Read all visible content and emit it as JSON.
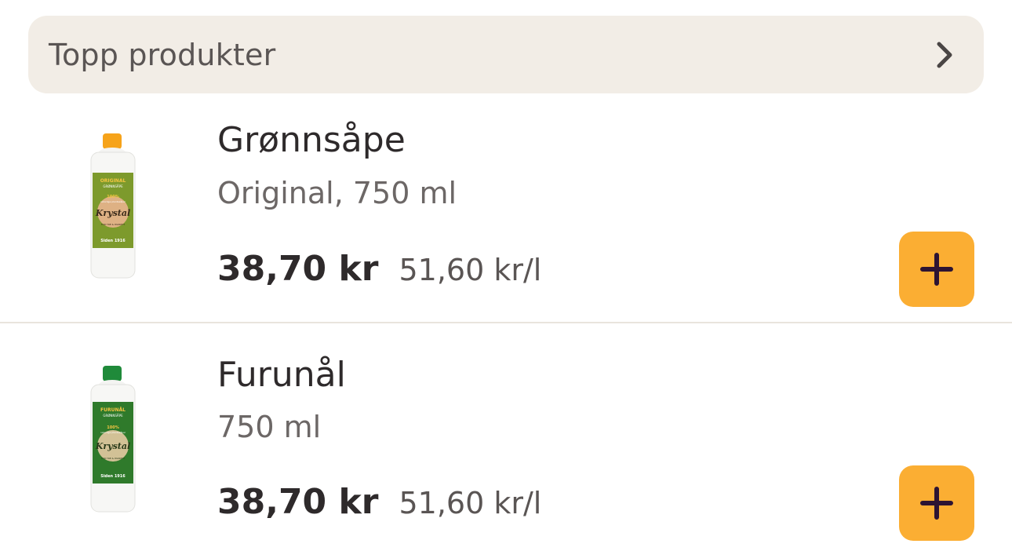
{
  "header": {
    "title": "Topp produkter",
    "icon": "chevron-right-icon"
  },
  "products": [
    {
      "name": "Grønnsåpe",
      "description": "Original, 750 ml",
      "price": "38,70 kr",
      "unit_price": "51,60 kr/l",
      "cap_color": "#f6a31a",
      "label_color": "#7d9a2c",
      "image_text": [
        "ORIGINAL",
        "GRØNNSÅPE",
        "100%",
        "naturlige plantesåper",
        "Krystal",
        "FOR TRE & PARKETT",
        "Siden 1916"
      ]
    },
    {
      "name": "Furunål",
      "description": "750 ml",
      "price": "38,70 kr",
      "unit_price": "51,60 kr/l",
      "cap_color": "#1f8a3a",
      "label_color": "#2f7a2b",
      "image_text": [
        "FURUNÅL",
        "GRØNNSÅPE",
        "100%",
        "naturlige plantesåper",
        "Krystal",
        "FOR TRE & PARKETT",
        "Siden 1916"
      ]
    }
  ],
  "add_button": {
    "icon": "plus-icon",
    "color": "#fbae33",
    "icon_color": "#2d1433"
  }
}
